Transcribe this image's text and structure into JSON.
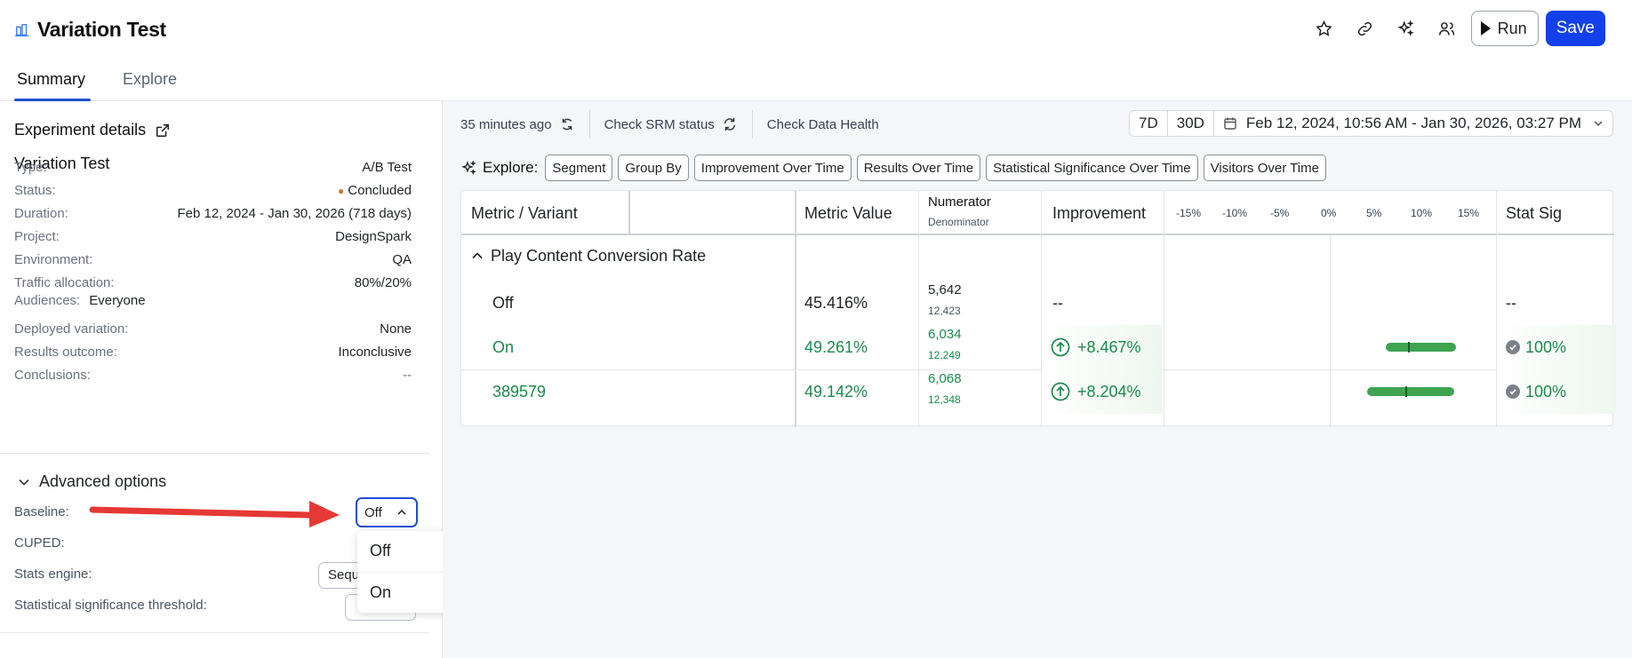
{
  "header": {
    "title": "Variation Test",
    "tabs": [
      {
        "label": "Summary",
        "active": true
      },
      {
        "label": "Explore",
        "active": false
      }
    ],
    "actions": {
      "run_label": "Run",
      "save_label": "Save",
      "icons": [
        "star-icon",
        "link-icon",
        "sparkle-icon",
        "users-icon"
      ]
    }
  },
  "details": {
    "heading": "Experiment details",
    "name": "Variation Test",
    "rows": [
      {
        "k": "Type:",
        "v": "A/B Test"
      },
      {
        "k": "Status:",
        "v": "Concluded"
      },
      {
        "k": "Duration:",
        "v": "Feb 12, 2024 - Jan 30, 2026 (718 days)"
      },
      {
        "k": "Project:",
        "v": "DesignSpark"
      },
      {
        "k": "Environment:",
        "v": "QA"
      },
      {
        "k": "Traffic allocation:",
        "v": "80%/20%"
      },
      {
        "k": "Audiences:",
        "v": "Everyone"
      },
      {
        "k": "Deployed variation:",
        "v": "None"
      },
      {
        "k": "Results outcome:",
        "v": "Inconclusive"
      },
      {
        "k": "Conclusions:",
        "v": "--"
      }
    ]
  },
  "advanced": {
    "heading": "Advanced options",
    "baseline_label": "Baseline:",
    "baseline_value": "Off",
    "cuped_label": "CUPED:",
    "stats_engine_label": "Stats engine:",
    "stats_engine_value": "Sequ",
    "sig_threshold_label": "Statistical significance threshold:",
    "dropdown_options": [
      "Off",
      "On"
    ]
  },
  "toolbar": {
    "updated": "35 minutes ago",
    "srm": "Check SRM status",
    "health": "Check Data Health",
    "range_7d": "7D",
    "range_30d": "30D",
    "date_range": "Feb 12, 2024, 10:56 AM - Jan 30, 2026, 03:27 PM"
  },
  "explore": {
    "label": "Explore:",
    "chips": [
      "Segment",
      "Group By",
      "Improvement Over Time",
      "Results Over Time",
      "Statistical Significance Over Time",
      "Visitors Over Time"
    ]
  },
  "table": {
    "headers": {
      "metric_variant": "Metric / Variant",
      "metric_value": "Metric Value",
      "numerator": "Numerator",
      "denominator": "Denominator",
      "improvement": "Improvement",
      "stat_sig": "Stat Sig"
    },
    "scale_labels": [
      "-15%",
      "-10%",
      "-5%",
      "0%",
      "5%",
      "10%",
      "15%"
    ],
    "metric_name": "Play Content Conversion Rate",
    "rows": [
      {
        "variant": "Off",
        "value": "45.416%",
        "numerator": "5,642",
        "denominator": "12,423",
        "improvement": "--",
        "stat_sig": "--",
        "bar": null
      },
      {
        "variant": "On",
        "value": "49.261%",
        "numerator": "6,034",
        "denominator": "12,249",
        "improvement": "+8.467%",
        "stat_sig": "100%",
        "bar": {
          "low": 6.0,
          "high": 13.5,
          "point": 8.467
        }
      },
      {
        "variant": "389579",
        "value": "49.142%",
        "numerator": "6,068",
        "denominator": "12,348",
        "improvement": "+8.204%",
        "stat_sig": "100%",
        "bar": {
          "low": 4.0,
          "high": 13.3,
          "point": 8.204
        }
      }
    ]
  },
  "colors": {
    "accent": "#1340e8",
    "positive": "#1b8a4a",
    "bar": "#3fa451",
    "annotation_arrow": "#e53935"
  }
}
